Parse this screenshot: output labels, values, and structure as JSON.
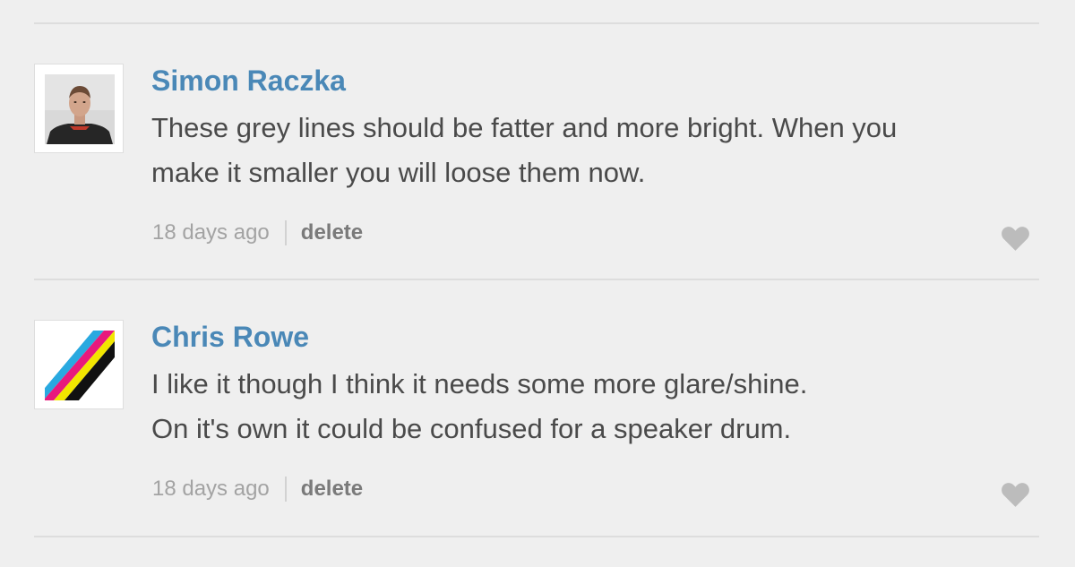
{
  "comments": [
    {
      "author": "Simon Raczka",
      "avatar_icon": "person-photo-avatar",
      "lines": [
        "These grey lines should be fatter and more bright. When you",
        "make it smaller you will loose them now."
      ],
      "time": "18 days ago",
      "delete_label": "delete",
      "like_icon": "heart-icon"
    },
    {
      "author": "Chris Rowe",
      "avatar_icon": "cmyk-stripes-avatar",
      "lines": [
        "I like it though I think it needs some more glare/shine.",
        "On it's own it could be confused for a speaker drum."
      ],
      "time": "18 days ago",
      "delete_label": "delete",
      "like_icon": "heart-icon"
    }
  ],
  "colors": {
    "author_link": "#4a88b7",
    "body_text": "#4a4a4a",
    "meta_text": "#a3a3a3",
    "delete_text": "#7a7a7a",
    "heart": "#bcbcbc",
    "divider": "#dddddd",
    "background": "#efefef"
  }
}
